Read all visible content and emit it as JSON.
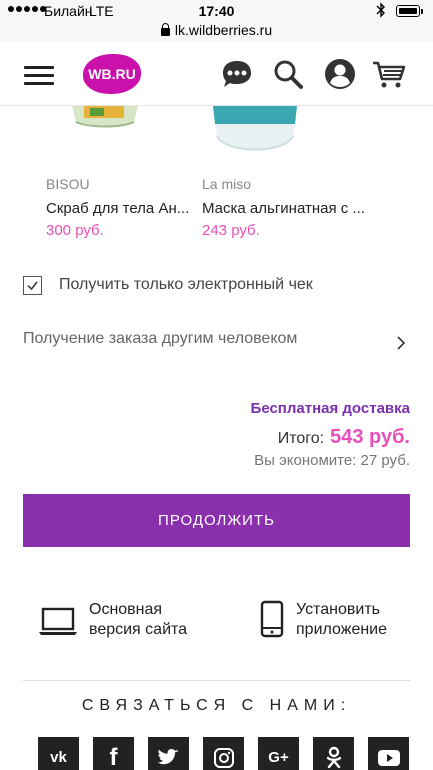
{
  "status_bar": {
    "carrier": "Билайн",
    "network": "LTE",
    "time": "17:40"
  },
  "url_bar": {
    "url": "lk.wildberries.ru"
  },
  "header": {
    "logo_text": "WB.RU",
    "brand_color": "#cb11ab"
  },
  "products": [
    {
      "brand": "BISOU",
      "name": "Скраб для тела Ан...",
      "price": "300 руб."
    },
    {
      "brand": "La miso",
      "name": "Маска альгинатная с ...",
      "price": "243 руб."
    }
  ],
  "receipt": {
    "label": "Получить только электронный чек",
    "checked": true
  },
  "other_person": {
    "label": "Получение заказа другим человеком"
  },
  "summary": {
    "free_delivery": "Бесплатная доставка",
    "total_label": "Итого:",
    "total_amount": "543 руб.",
    "savings": "Вы экономите: 27 руб."
  },
  "continue_button": {
    "label": "ПРОДОЛЖИТЬ",
    "color": "#8b30ad"
  },
  "footer": {
    "main_site": {
      "line1": "Основная",
      "line2": "версия сайта"
    },
    "install_app": {
      "line1": "Установить",
      "line2": "приложение"
    },
    "contact_title": "СВЯЗАТЬСЯ С НАМИ:",
    "socials": [
      {
        "icon": "vk-icon",
        "glyph": "vk"
      },
      {
        "icon": "facebook-icon",
        "glyph": "f"
      },
      {
        "icon": "twitter-icon",
        "glyph": "t"
      },
      {
        "icon": "instagram-icon",
        "glyph": ""
      },
      {
        "icon": "google-plus-icon",
        "glyph": "G+"
      },
      {
        "icon": "odnoklassniki-icon",
        "glyph": ""
      },
      {
        "icon": "youtube-icon",
        "glyph": ""
      }
    ]
  },
  "accent_price_color": "#e84fb8"
}
